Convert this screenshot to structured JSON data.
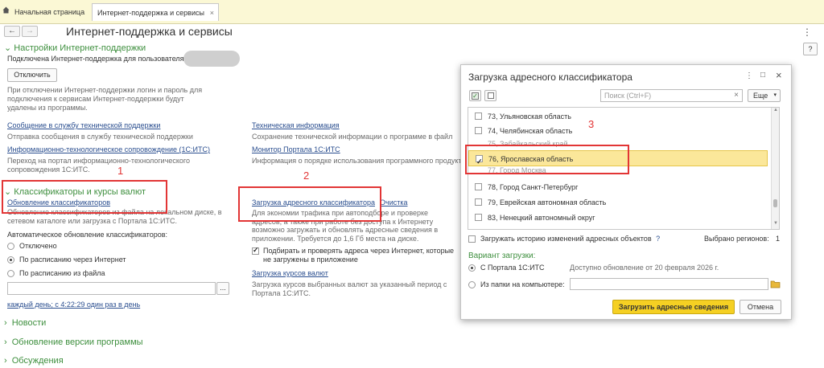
{
  "tabs": [
    {
      "label": "Начальная страница"
    },
    {
      "label": "Интернет-поддержка и сервисы"
    }
  ],
  "tab_close": "×",
  "page": {
    "title": "Интернет-поддержка и сервисы",
    "more_menu": "⋮",
    "help": "?",
    "settings": {
      "header": "Настройки Интернет-поддержки",
      "user_text": "Подключена Интернет-поддержка для пользователя",
      "disconnect_button": "Отключить",
      "disconnect_note": "При отключении Интернет-поддержки логин и пароль для подключения к сервисам Интернет-поддержки будут удалены из программы."
    },
    "links_left": [
      {
        "label": "Сообщение в службу технической поддержки",
        "desc": "Отправка сообщения в службу технической поддержки"
      },
      {
        "label": "Информационно-технологическое сопровождение (1С:ИТС)",
        "desc": "Переход на портал информационно-технологического сопровождения 1С:ИТС."
      }
    ],
    "links_right": [
      {
        "label": "Техническая информация",
        "desc": "Сохранение технической информации о программе в файл"
      },
      {
        "label": "Монитор Портала 1С:ИТС",
        "desc": "Информация о порядке использования программного продукта и др."
      }
    ],
    "classifiers": {
      "header": "Классификаторы и курсы валют",
      "update_link": "Обновление классификаторов",
      "update_desc": "Обновление классификаторов из файла на локальном диске, в сетевом каталоге или загрузка с Портала 1С:ИТС.",
      "auto_label": "Автоматическое обновление классификаторов:",
      "radio_options": [
        "Отключено",
        "По расписанию через Интернет",
        "По расписанию из файла"
      ],
      "selected_radio": 1,
      "file_path": "",
      "browse": "...",
      "schedule_link": "каждый день; с 4:22:29 один раз в день",
      "address_link": "Загрузка адресного классификатора",
      "clean_link": "Очистка",
      "address_desc": "Для экономии трафика при автоподборе и проверке адресов, а также при работе без доступа к Интернету возможно загружать и обновлять адресные сведения в приложении. Требуется до 1,6 Гб места на диске.",
      "check_label": "Подбирать и проверять адреса через Интернет, которые не загружены в приложение",
      "check_on": true,
      "currency_link": "Загрузка курсов валют",
      "currency_desc": "Загрузка курсов выбранных валют за указанный период с Портала 1С:ИТС."
    },
    "sections": [
      "Новости",
      "Обновление версии программы",
      "Обсуждения"
    ]
  },
  "dialog": {
    "title": "Загрузка адресного классификатора",
    "window_controls": [
      "⋮",
      "□",
      "×"
    ],
    "search_placeholder": "Поиск (Ctrl+F)",
    "search_clear": "×",
    "more_button": "Еще",
    "regions": [
      {
        "label": "73, Ульяновская область",
        "checked": false
      },
      {
        "label": "74, Челябинская область",
        "checked": false
      },
      {
        "label": "75, Забайкальский край",
        "checked": false
      },
      {
        "label": "76, Ярославская область",
        "checked": true
      },
      {
        "label": "77, Город Москва",
        "checked": false
      },
      {
        "label": "78, Город Санкт-Петербург",
        "checked": false
      },
      {
        "label": "79, Еврейская автономная область",
        "checked": false
      },
      {
        "label": "83, Ненецкий автономный округ",
        "checked": false
      }
    ],
    "history_label": "Загружать историю изменений адресных объектов",
    "history_help": "?",
    "selected_label": "Выбрано регионов:",
    "selected_count": "1",
    "variant_header": "Вариант загрузки:",
    "variant_portal": "С Портала 1С:ИТС",
    "variant_portal_note": "Доступно обновление от 20 февраля 2026 г.",
    "variant_folder": "Из папки на компьютере:",
    "load_button": "Загрузить адресные сведения",
    "cancel_button": "Отмена"
  },
  "annotations": [
    "1",
    "2",
    "3"
  ],
  "colors": {
    "accent_green": "#3e8f3e",
    "link_blue": "#2a4e8f",
    "highlight_yellow": "#fbe79a",
    "primary_button": "#f5d023",
    "annotation_red": "#e23535"
  }
}
